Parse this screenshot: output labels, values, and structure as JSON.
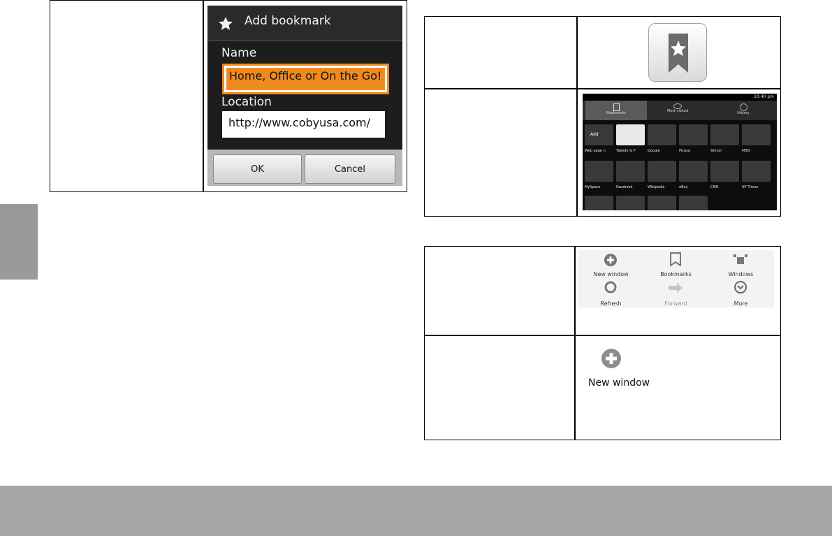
{
  "dialog": {
    "title": "Add bookmark",
    "name_label": "Name",
    "name_value": "Home, Office or On the Go!",
    "location_label": "Location",
    "location_value": "http://www.cobyusa.com/",
    "ok_label": "OK",
    "cancel_label": "Cancel"
  },
  "bookmarks_screen": {
    "clock": "10:40 pm",
    "tabs": [
      "Bookmarks",
      "Most visited",
      "History"
    ],
    "add_label": "Add",
    "thumbnails": [
      "Web page n",
      "Tablets & P",
      "Google",
      "Picasa",
      "Yahoo!",
      "MSN",
      "MySpace",
      "Facebook",
      "Wikipedia",
      "eBay",
      "CNN",
      "NY Times"
    ]
  },
  "menu": {
    "items": [
      "New window",
      "Bookmarks",
      "Windows",
      "Refresh",
      "Forward",
      "More"
    ]
  },
  "new_window": {
    "label": "New window"
  },
  "colors": {
    "highlight": "#f08a1e",
    "side_tab": "#9a9a9a",
    "footer": "#a6a6a6"
  }
}
